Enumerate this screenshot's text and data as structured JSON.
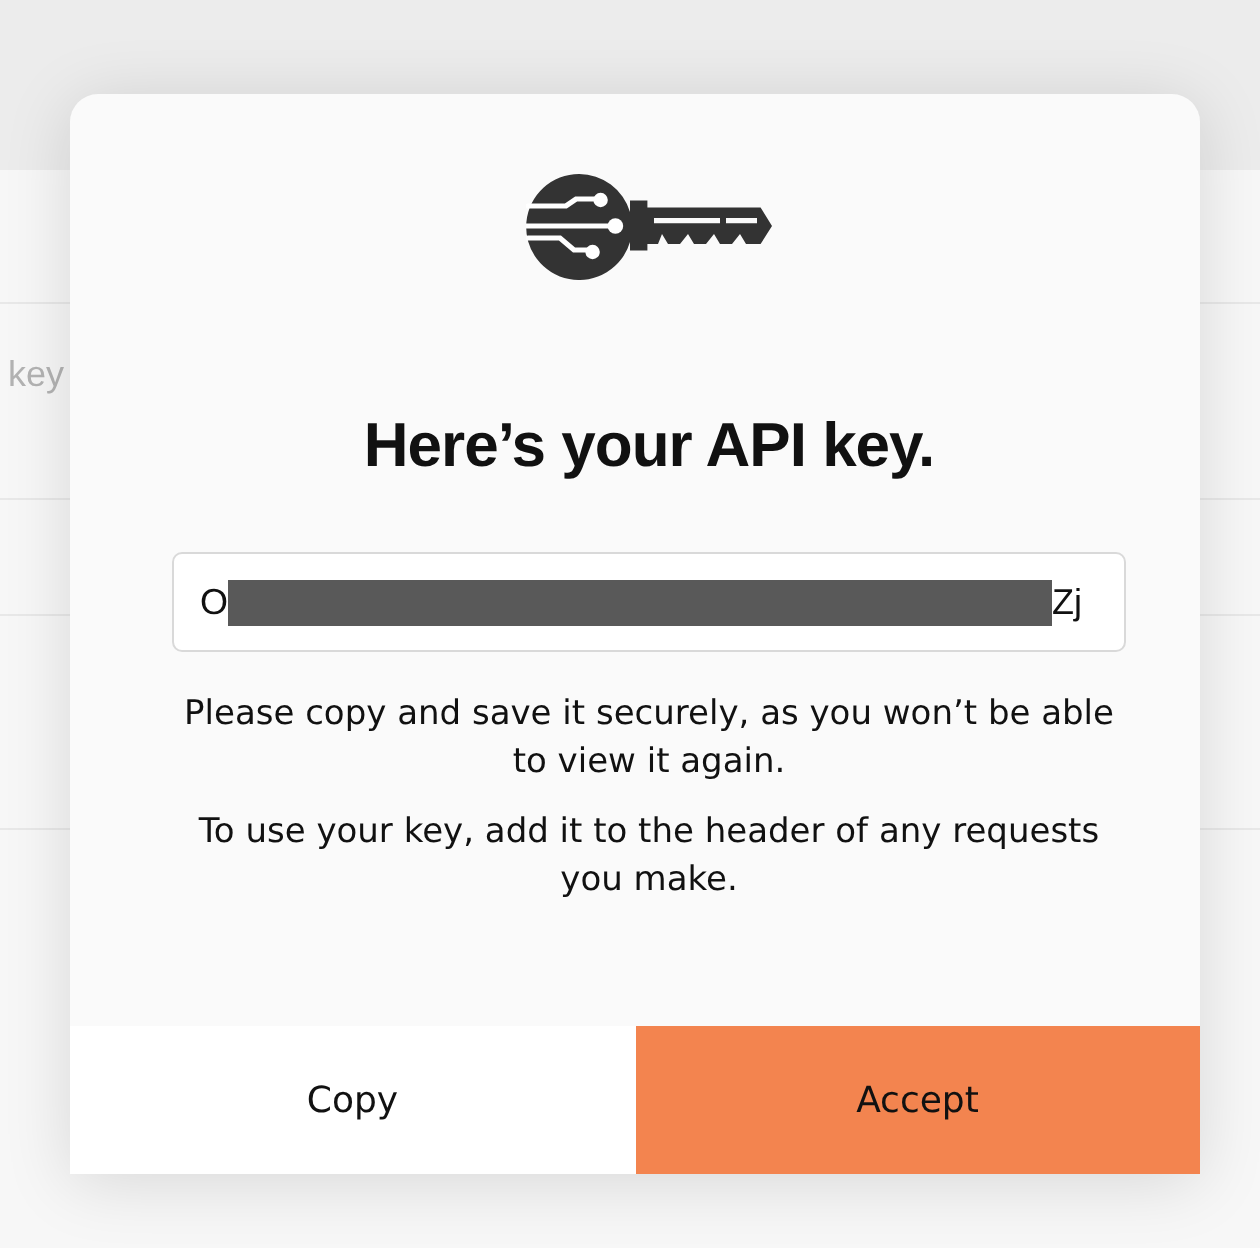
{
  "backdrop": {
    "text": "key"
  },
  "dialog": {
    "title": "Here’s your API key.",
    "key_field": {
      "value_start": "O",
      "redacted": true,
      "value_end": "Zj"
    },
    "paragraphs": [
      "Please copy and save it securely, as you won’t be able to view it again.",
      "To use your key, add it to the header of any requests you make."
    ],
    "buttons": [
      {
        "label": "Copy",
        "kind": "secondary"
      },
      {
        "label": "Accept",
        "kind": "primary"
      }
    ]
  }
}
